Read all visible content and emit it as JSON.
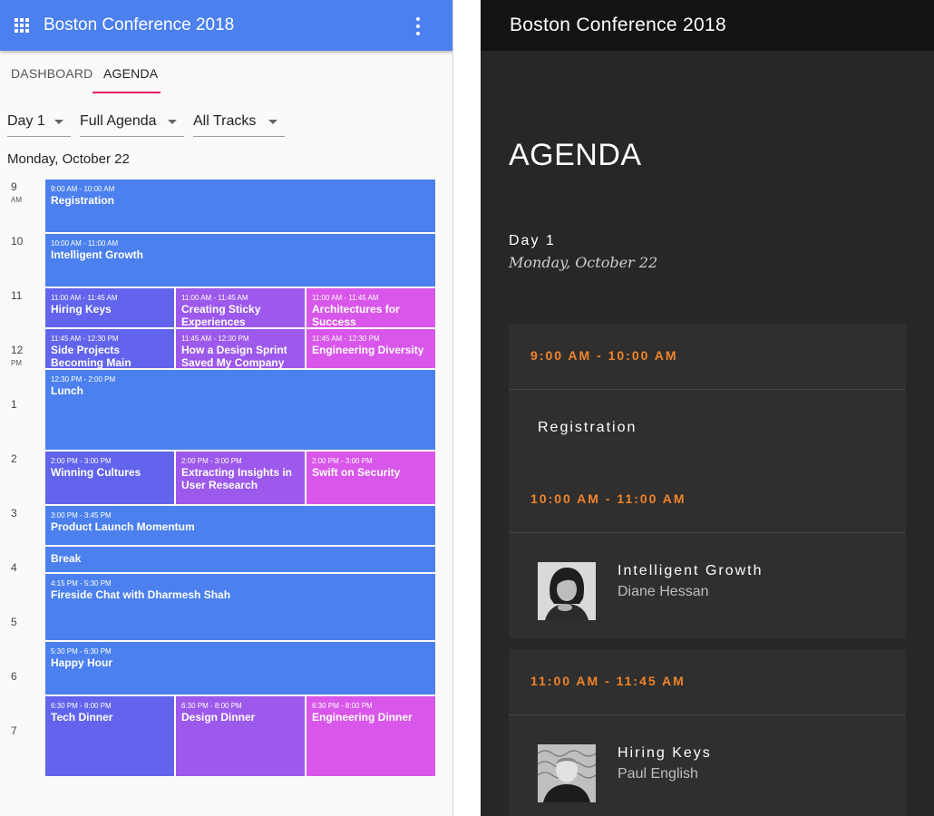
{
  "app": {
    "title": "Boston Conference 2018",
    "icons": {
      "menu": "apps-grid-icon",
      "more": "more-vert-icon"
    },
    "colors": {
      "header": "#4b80ee",
      "tab_indicator": "#e91e63",
      "track_blue": "#4b80ee",
      "track_indigo": "#6264ed",
      "track_purple": "#9d59ec",
      "track_magenta": "#d956ea"
    }
  },
  "tabs": [
    {
      "label": "DASHBOARD",
      "active": false
    },
    {
      "label": "AGENDA",
      "active": true
    }
  ],
  "filters": {
    "day": "Day 1",
    "agenda": "Full Agenda",
    "tracks": "All Tracks"
  },
  "schedule": {
    "date": "Monday, October 22",
    "hours": [
      {
        "label": "9",
        "ampm": "AM"
      },
      {
        "label": "10"
      },
      {
        "label": "11"
      },
      {
        "label": "12",
        "ampm": "PM"
      },
      {
        "label": "1"
      },
      {
        "label": "2"
      },
      {
        "label": "3"
      },
      {
        "label": "4"
      },
      {
        "label": "5"
      },
      {
        "label": "6"
      },
      {
        "label": "7"
      }
    ],
    "events": [
      {
        "time": "9:00 AM - 10:00 AM",
        "name": "Registration"
      },
      {
        "time": "10:00 AM - 11:00 AM",
        "name": "Intelligent Growth"
      },
      {
        "time": "11:00 AM - 11:45 AM",
        "name": "Hiring Keys"
      },
      {
        "time": "11:00 AM - 11:45 AM",
        "name": "Creating Sticky Experiences"
      },
      {
        "time": "11:00 AM - 11:45 AM",
        "name": "Architectures for Success"
      },
      {
        "time": "11:45 AM - 12:30 PM",
        "name": "Side Projects Becoming Main Projects"
      },
      {
        "time": "11:45 AM - 12:30 PM",
        "name": "How a Design Sprint Saved My Company"
      },
      {
        "time": "11:45 AM - 12:30 PM",
        "name": "Engineering Diversity"
      },
      {
        "time": "12:30 PM - 2:00 PM",
        "name": "Lunch"
      },
      {
        "time": "2:00 PM - 3:00 PM",
        "name": "Winning Cultures"
      },
      {
        "time": "2:00 PM - 3:00 PM",
        "name": "Extracting Insights in User Research"
      },
      {
        "time": "2:00 PM - 3:00 PM",
        "name": "Swift on Security"
      },
      {
        "time": "3:00 PM - 3:45 PM",
        "name": "Product Launch Momentum"
      },
      {
        "name": "Break"
      },
      {
        "time": "4:15 PM - 5:30 PM",
        "name": "Fireside Chat with Dharmesh Shah"
      },
      {
        "time": "5:30 PM - 6:30 PM",
        "name": "Happy Hour"
      },
      {
        "time": "6:30 PM - 8:00 PM",
        "name": "Tech Dinner"
      },
      {
        "time": "6:30 PM - 8:00 PM",
        "name": "Design Dinner"
      },
      {
        "time": "6:30 PM - 8:00 PM",
        "name": "Engineering Dinner"
      }
    ]
  },
  "mobile": {
    "title": "Boston Conference 2018",
    "heading": "AGENDA",
    "day": "Day 1",
    "date": "Monday, October 22",
    "slots": [
      {
        "time": "9:00 AM - 10:00 AM",
        "talk": "Registration"
      },
      {
        "time": "10:00 AM - 11:00 AM",
        "talk": "Intelligent Growth",
        "speaker": "Diane Hessan"
      },
      {
        "time": "11:00 AM - 11:45 AM",
        "talk": "Hiring Keys",
        "speaker": "Paul English"
      }
    ]
  }
}
